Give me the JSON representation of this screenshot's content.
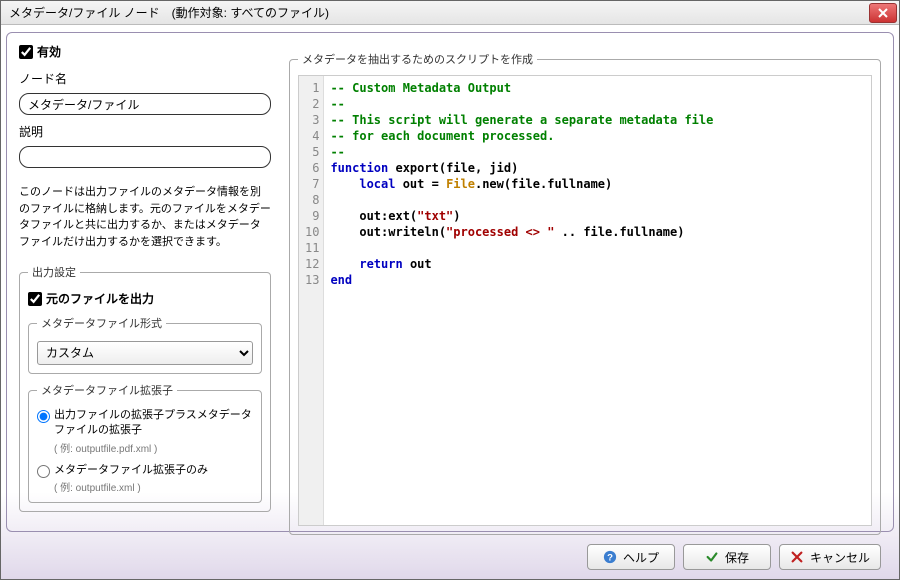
{
  "titlebar": {
    "title": "メタデータ/ファイル ノード　(動作対象: すべてのファイル)"
  },
  "left": {
    "enabled_label": "有効",
    "name_label": "ノード名",
    "name_value": "メタデータ/ファイル",
    "description_label": "説明",
    "description_value": "",
    "help_text": "このノードは出力ファイルのメタデータ情報を別のファイルに格納します。元のファイルをメタデータファイルと共に出力するか、またはメタデータファイルだけ出力するかを選択できます。",
    "output_legend": "出力設定",
    "output_original_label": "元のファイルを出力",
    "format_legend": "メタデータファイル形式",
    "format_value": "カスタム",
    "ext_legend": "メタデータファイル拡張子",
    "radio1_label": "出力ファイルの拡張子プラスメタデータファイルの拡張子",
    "radio1_example": "( 例: outputfile.pdf.xml )",
    "radio2_label": "メタデータファイル拡張子のみ",
    "radio2_example": "( 例: outputfile.xml )"
  },
  "right": {
    "legend": "メタデータを抽出するためのスクリプトを作成"
  },
  "code": {
    "lines": [
      {
        "n": 1,
        "t": "comment",
        "text": "-- Custom Metadata Output"
      },
      {
        "n": 2,
        "t": "comment",
        "text": "--"
      },
      {
        "n": 3,
        "t": "comment",
        "text": "-- This script will generate a separate metadata file"
      },
      {
        "n": 4,
        "t": "comment",
        "text": "-- for each document processed."
      },
      {
        "n": 5,
        "t": "comment",
        "text": "--"
      },
      {
        "n": 6,
        "t": "code",
        "segments": [
          [
            "keyword",
            "function"
          ],
          [
            "plain",
            " "
          ],
          [
            "ident",
            "export"
          ],
          [
            "plain",
            "(file, jid)"
          ]
        ]
      },
      {
        "n": 7,
        "t": "code",
        "segments": [
          [
            "plain",
            "    "
          ],
          [
            "keyword",
            "local"
          ],
          [
            "plain",
            " out = "
          ],
          [
            "type",
            "File"
          ],
          [
            "plain",
            ".new(file.fullname)"
          ]
        ]
      },
      {
        "n": 8,
        "t": "blank"
      },
      {
        "n": 9,
        "t": "code",
        "segments": [
          [
            "plain",
            "    out:ext("
          ],
          [
            "string",
            "\"txt\""
          ],
          [
            "plain",
            ")"
          ]
        ]
      },
      {
        "n": 10,
        "t": "code",
        "segments": [
          [
            "plain",
            "    out:writeln("
          ],
          [
            "string",
            "\"processed <> \""
          ],
          [
            "plain",
            " .. file.fullname)"
          ]
        ]
      },
      {
        "n": 11,
        "t": "blank"
      },
      {
        "n": 12,
        "t": "code",
        "segments": [
          [
            "plain",
            "    "
          ],
          [
            "keyword",
            "return"
          ],
          [
            "plain",
            " out"
          ]
        ]
      },
      {
        "n": 13,
        "t": "code",
        "segments": [
          [
            "keyword",
            "end"
          ]
        ]
      }
    ]
  },
  "footer": {
    "help": "ヘルプ",
    "save": "保存",
    "cancel": "キャンセル"
  }
}
